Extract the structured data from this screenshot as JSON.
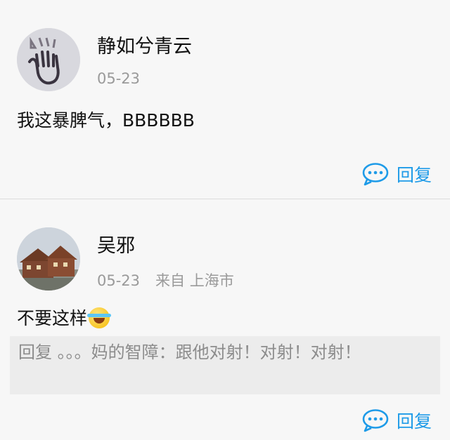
{
  "comments": [
    {
      "user": "静如兮青云",
      "date": "05-23",
      "text": "我这暴脾气，BBBBBB",
      "reply_label": "回复"
    },
    {
      "user": "吴邪",
      "date": "05-23",
      "source": "来自 上海市",
      "text": "不要这样",
      "quote": "回复 。。。妈的智障：跟他对射！对射！对射！",
      "reply_label": "回复"
    }
  ],
  "colors": {
    "accent": "#1e9be8",
    "muted": "#9a9a9a",
    "background": "#f7f7f7"
  },
  "icons": [
    "reply-bubble-icon",
    "laughing-crying-emoji-icon"
  ]
}
